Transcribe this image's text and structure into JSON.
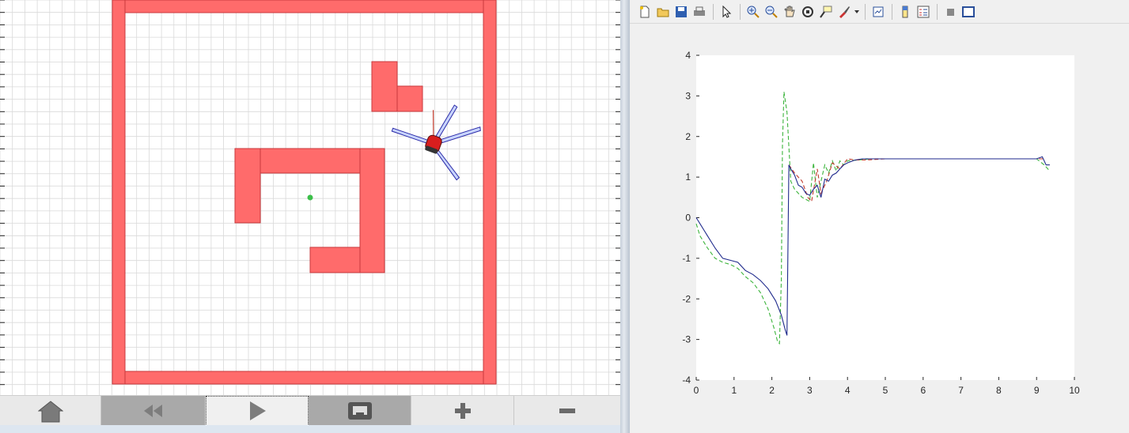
{
  "simulator": {
    "toolbar": [
      {
        "name": "home-button",
        "icon": "home-icon"
      },
      {
        "name": "rewind-button",
        "icon": "rewind-icon"
      },
      {
        "name": "play-button",
        "icon": "play-icon"
      },
      {
        "name": "network-button",
        "icon": "ethernet-icon"
      },
      {
        "name": "zoom-in-button",
        "icon": "plus-icon"
      },
      {
        "name": "zoom-out-button",
        "icon": "minus-icon"
      }
    ],
    "colors": {
      "wall": "#ff6b6b",
      "wall_edge": "#c9383c",
      "robot": "#d81e1e",
      "sensor": "#2c2ca8",
      "goal": "#3cbf4a",
      "grid": "#d9d9d9"
    }
  },
  "figure": {
    "toolbar_icons": [
      "new-file-icon",
      "open-folder-icon",
      "save-icon",
      "print-icon",
      "pointer-icon",
      "zoom-in-icon",
      "zoom-out-icon",
      "pan-hand-icon",
      "rotate-3d-icon",
      "data-cursor-icon",
      "brush-icon",
      "link-plot-icon",
      "colorbar-icon",
      "legend-icon",
      "hide-tools-icon",
      "dock-icon"
    ]
  },
  "chart_data": {
    "type": "line",
    "title": "",
    "xlabel": "",
    "ylabel": "",
    "xlim": [
      0,
      10
    ],
    "ylim": [
      -4,
      4
    ],
    "xticks": [
      "0",
      "1",
      "2",
      "3",
      "4",
      "5",
      "6",
      "7",
      "8",
      "9",
      "10"
    ],
    "yticks": [
      "4",
      "3",
      "2",
      "1",
      "0",
      "-1",
      "-2",
      "-3",
      "-4"
    ],
    "grid": false,
    "series": [
      {
        "color": "#3cb43c",
        "style": "dashed",
        "x": [
          0,
          0.1,
          0.3,
          0.5,
          0.7,
          0.9,
          1.1,
          1.3,
          1.5,
          1.7,
          1.9,
          2.05,
          2.15,
          2.2,
          2.25,
          2.28,
          2.32,
          2.4,
          2.5,
          2.6,
          2.8,
          3.0,
          3.1,
          3.2,
          3.3,
          3.4,
          3.5,
          3.6,
          3.7,
          3.8,
          3.9,
          4.0,
          4.3,
          4.6,
          5,
          5.5,
          6,
          6.5,
          7,
          7.5,
          8,
          8.5,
          9,
          9.2,
          9.35
        ],
        "y": [
          -0.15,
          -0.45,
          -0.75,
          -1.0,
          -1.1,
          -1.15,
          -1.25,
          -1.45,
          -1.6,
          -1.85,
          -2.25,
          -2.7,
          -3.05,
          -3.1,
          -1.5,
          1.8,
          3.1,
          2.6,
          0.9,
          0.7,
          0.5,
          0.4,
          1.35,
          0.5,
          0.9,
          1.3,
          1.1,
          1.4,
          1.15,
          1.4,
          1.3,
          1.4,
          1.42,
          1.45,
          1.45,
          1.45,
          1.45,
          1.45,
          1.45,
          1.45,
          1.45,
          1.45,
          1.45,
          1.3,
          1.15
        ]
      },
      {
        "color": "#c0392b",
        "style": "dashed",
        "x": [
          2.45,
          2.6,
          2.8,
          2.95,
          3.05,
          3.2,
          3.3,
          3.45,
          3.6,
          3.8,
          4.0,
          4.2,
          4.5,
          5,
          5.5,
          6,
          6.5,
          7,
          7.5,
          8,
          8.5,
          9,
          9.2
        ],
        "y": [
          1.3,
          1.1,
          0.9,
          0.5,
          0.4,
          1.2,
          0.6,
          0.9,
          1.35,
          1.2,
          1.45,
          1.42,
          1.42,
          1.45,
          1.45,
          1.45,
          1.45,
          1.45,
          1.45,
          1.45,
          1.45,
          1.45,
          1.45
        ]
      },
      {
        "color": "#1f2a8c",
        "style": "solid",
        "x": [
          0,
          0.1,
          0.3,
          0.5,
          0.7,
          0.9,
          1.1,
          1.3,
          1.5,
          1.7,
          1.9,
          2.1,
          2.25,
          2.35,
          2.4,
          2.45,
          2.5,
          2.6,
          2.7,
          2.8,
          2.9,
          3.0,
          3.1,
          3.2,
          3.3,
          3.4,
          3.5,
          3.6,
          3.7,
          3.8,
          3.9,
          4.0,
          4.2,
          4.4,
          4.6,
          5,
          5.5,
          6,
          6.5,
          7,
          7.5,
          8,
          8.5,
          9,
          9.15,
          9.25,
          9.35
        ],
        "y": [
          0,
          -0.15,
          -0.45,
          -0.75,
          -1.0,
          -1.05,
          -1.1,
          -1.3,
          -1.4,
          -1.55,
          -1.75,
          -2.05,
          -2.4,
          -2.75,
          -2.9,
          1.3,
          1.2,
          1.05,
          0.8,
          0.75,
          0.6,
          0.55,
          0.7,
          0.8,
          0.5,
          0.95,
          0.9,
          1.05,
          1.1,
          1.2,
          1.3,
          1.35,
          1.42,
          1.45,
          1.45,
          1.45,
          1.45,
          1.45,
          1.45,
          1.45,
          1.45,
          1.45,
          1.45,
          1.45,
          1.5,
          1.3,
          1.3
        ]
      }
    ]
  }
}
